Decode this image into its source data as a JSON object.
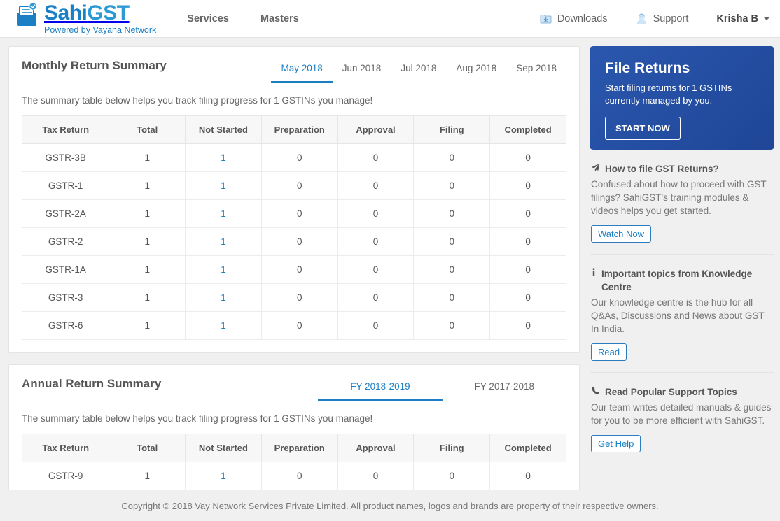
{
  "header": {
    "brand": {
      "name_dark": "Sahi",
      "name_light": "GST",
      "tagline": "Powered by Vayana Network"
    },
    "nav": [
      {
        "label": "Services"
      },
      {
        "label": "Masters"
      }
    ],
    "right": {
      "downloads_label": "Downloads",
      "downloads_icon": "download-folder-icon",
      "support_label": "Support",
      "support_icon": "support-agent-icon",
      "user_label": "Krisha B",
      "user_caret_icon": "chevron-down-icon"
    }
  },
  "monthly": {
    "title": "Monthly Return Summary",
    "tabs": [
      {
        "label": "May 2018",
        "active": true
      },
      {
        "label": "Jun 2018",
        "active": false
      },
      {
        "label": "Jul 2018",
        "active": false
      },
      {
        "label": "Aug 2018",
        "active": false
      },
      {
        "label": "Sep 2018",
        "active": false
      }
    ],
    "helper": "The summary table below helps you track filing progress for 1 GSTINs you manage!",
    "columns": [
      "Tax Return",
      "Total",
      "Not Started",
      "Preparation",
      "Approval",
      "Filing",
      "Completed"
    ],
    "rows": [
      {
        "tax_return": "GSTR-3B",
        "total": "1",
        "not_started": "1",
        "preparation": "0",
        "approval": "0",
        "filing": "0",
        "completed": "0"
      },
      {
        "tax_return": "GSTR-1",
        "total": "1",
        "not_started": "1",
        "preparation": "0",
        "approval": "0",
        "filing": "0",
        "completed": "0"
      },
      {
        "tax_return": "GSTR-2A",
        "total": "1",
        "not_started": "1",
        "preparation": "0",
        "approval": "0",
        "filing": "0",
        "completed": "0"
      },
      {
        "tax_return": "GSTR-2",
        "total": "1",
        "not_started": "1",
        "preparation": "0",
        "approval": "0",
        "filing": "0",
        "completed": "0"
      },
      {
        "tax_return": "GSTR-1A",
        "total": "1",
        "not_started": "1",
        "preparation": "0",
        "approval": "0",
        "filing": "0",
        "completed": "0"
      },
      {
        "tax_return": "GSTR-3",
        "total": "1",
        "not_started": "1",
        "preparation": "0",
        "approval": "0",
        "filing": "0",
        "completed": "0"
      },
      {
        "tax_return": "GSTR-6",
        "total": "1",
        "not_started": "1",
        "preparation": "0",
        "approval": "0",
        "filing": "0",
        "completed": "0"
      }
    ]
  },
  "annual": {
    "title": "Annual Return Summary",
    "tabs": [
      {
        "label": "FY 2018-2019",
        "active": true
      },
      {
        "label": "FY 2017-2018",
        "active": false
      }
    ],
    "helper": "The summary table below helps you track filing progress for 1 GSTINs you manage!",
    "columns": [
      "Tax Return",
      "Total",
      "Not Started",
      "Preparation",
      "Approval",
      "Filing",
      "Completed"
    ],
    "rows": [
      {
        "tax_return": "GSTR-9",
        "total": "1",
        "not_started": "1",
        "preparation": "0",
        "approval": "0",
        "filing": "0",
        "completed": "0"
      }
    ]
  },
  "sidebar": {
    "promo": {
      "title": "File Returns",
      "subtitle": "Start filing returns for 1 GSTINs currently managed by you.",
      "button": "START NOW",
      "bg_color": "#2250a8"
    },
    "sections": [
      {
        "icon": "paper-plane-icon",
        "title": "How to file GST Returns?",
        "text": "Confused about how to proceed with GST filings? SahiGST's training modules & videos helps you get started.",
        "button": "Watch Now"
      },
      {
        "icon": "info-icon",
        "title": "Important topics from Knowledge Centre",
        "text": "Our knowledge centre is the hub for all Q&As, Discussions and News about GST In India.",
        "button": "Read"
      },
      {
        "icon": "phone-icon",
        "title": "Read Popular Support Topics",
        "text": "Our team writes detailed manuals & guides for you to be more efficient with SahiGST.",
        "button": "Get Help"
      }
    ]
  },
  "footer": {
    "copyright": "Copyright © 2018 Vay Network Services Private Limited. All product names, logos and brands are property of their respective owners."
  },
  "theme": {
    "accent": "#1a7fc4",
    "promo_blue": "#2250a8",
    "page_bg": "#f0f0f0"
  }
}
